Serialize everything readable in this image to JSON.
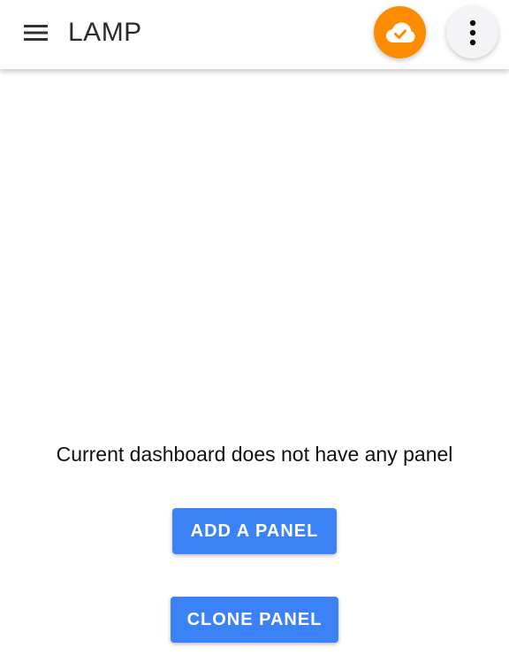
{
  "colors": {
    "sync_button_bg": "#fb8c00",
    "primary_button_bg": "#3b82f6",
    "icon_color": "#333333"
  },
  "header": {
    "title": "LAMP",
    "menu_icon": "hamburger-menu-icon",
    "sync_icon": "cloud-done-icon",
    "more_icon": "more-vertical-icon"
  },
  "main": {
    "empty_message": "Current dashboard does not have any panel",
    "add_panel_label": "ADD A PANEL",
    "clone_panel_label": "CLONE PANEL"
  }
}
